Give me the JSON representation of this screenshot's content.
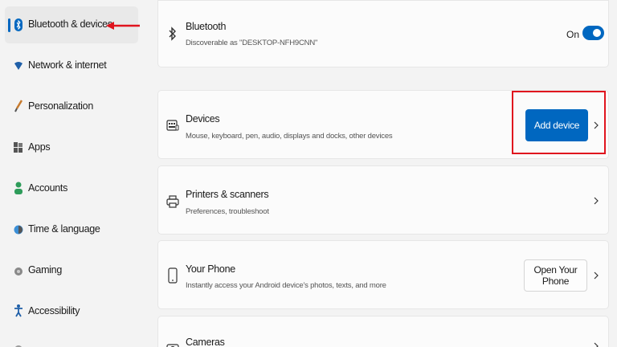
{
  "sidebar": {
    "items": [
      {
        "label": "Bluetooth & devices",
        "icon": "bluetooth-icon",
        "active": true
      },
      {
        "label": "Network & internet",
        "icon": "wifi-icon"
      },
      {
        "label": "Personalization",
        "icon": "brush-icon"
      },
      {
        "label": "Apps",
        "icon": "apps-icon"
      },
      {
        "label": "Accounts",
        "icon": "person-icon"
      },
      {
        "label": "Time & language",
        "icon": "globe-clock-icon"
      },
      {
        "label": "Gaming",
        "icon": "gamepad-icon"
      },
      {
        "label": "Accessibility",
        "icon": "accessibility-icon"
      }
    ]
  },
  "cards": {
    "bluetooth": {
      "title": "Bluetooth",
      "desc": "Discoverable as \"DESKTOP-NFH9CNN\"",
      "toggle_label": "On",
      "toggle_state": true,
      "icon": "bluetooth-icon"
    },
    "devices": {
      "title": "Devices",
      "desc": "Mouse, keyboard, pen, audio, displays and docks, other devices",
      "button": "Add device",
      "icon": "devices-icon"
    },
    "printers": {
      "title": "Printers & scanners",
      "desc": "Preferences, troubleshoot",
      "icon": "printer-icon"
    },
    "phone": {
      "title": "Your Phone",
      "desc": "Instantly access your Android device's photos, texts, and more",
      "button": "Open Your Phone",
      "icon": "phone-icon"
    },
    "cameras": {
      "title": "Cameras",
      "icon": "camera-icon"
    }
  },
  "colors": {
    "accent": "#0067c0",
    "annotation": "#e0141e"
  }
}
